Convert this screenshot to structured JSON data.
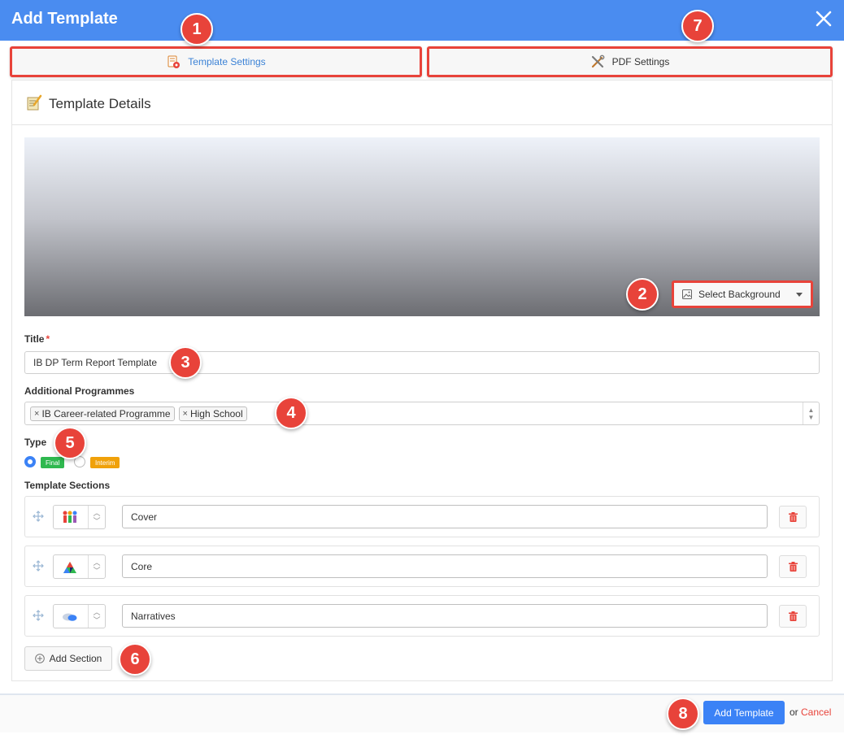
{
  "header": {
    "title": "Add Template"
  },
  "tabs": {
    "template_settings": "Template Settings",
    "pdf_settings": "PDF Settings"
  },
  "panel": {
    "title": "Template Details",
    "select_background": "Select Background"
  },
  "form": {
    "title_label": "Title",
    "title_required_mark": "*",
    "title_value": "IB DP Term Report Template",
    "programmes_label": "Additional Programmes",
    "programmes": [
      "IB Career-related Programme",
      "High School"
    ],
    "chip_remove": "×",
    "type_label": "Type",
    "type_options": [
      {
        "label": "Final",
        "selected": true,
        "color": "#2fb84f"
      },
      {
        "label": "Interim",
        "selected": false,
        "color": "#f0a10a"
      }
    ],
    "sections_label": "Template Sections",
    "sections": [
      {
        "name": "Cover",
        "icon": "people-icon"
      },
      {
        "name": "Core",
        "icon": "triangle-icon"
      },
      {
        "name": "Narratives",
        "icon": "speech-bubbles-icon"
      }
    ],
    "add_section": "Add Section"
  },
  "footer": {
    "add_template": "Add Template",
    "or": "or",
    "cancel": "Cancel"
  },
  "callouts": [
    "1",
    "2",
    "3",
    "4",
    "5",
    "6",
    "7",
    "8"
  ],
  "colors": {
    "header_bg": "#4a8cf0",
    "accent_red": "#e8433a",
    "primary_button": "#3b82f6"
  }
}
